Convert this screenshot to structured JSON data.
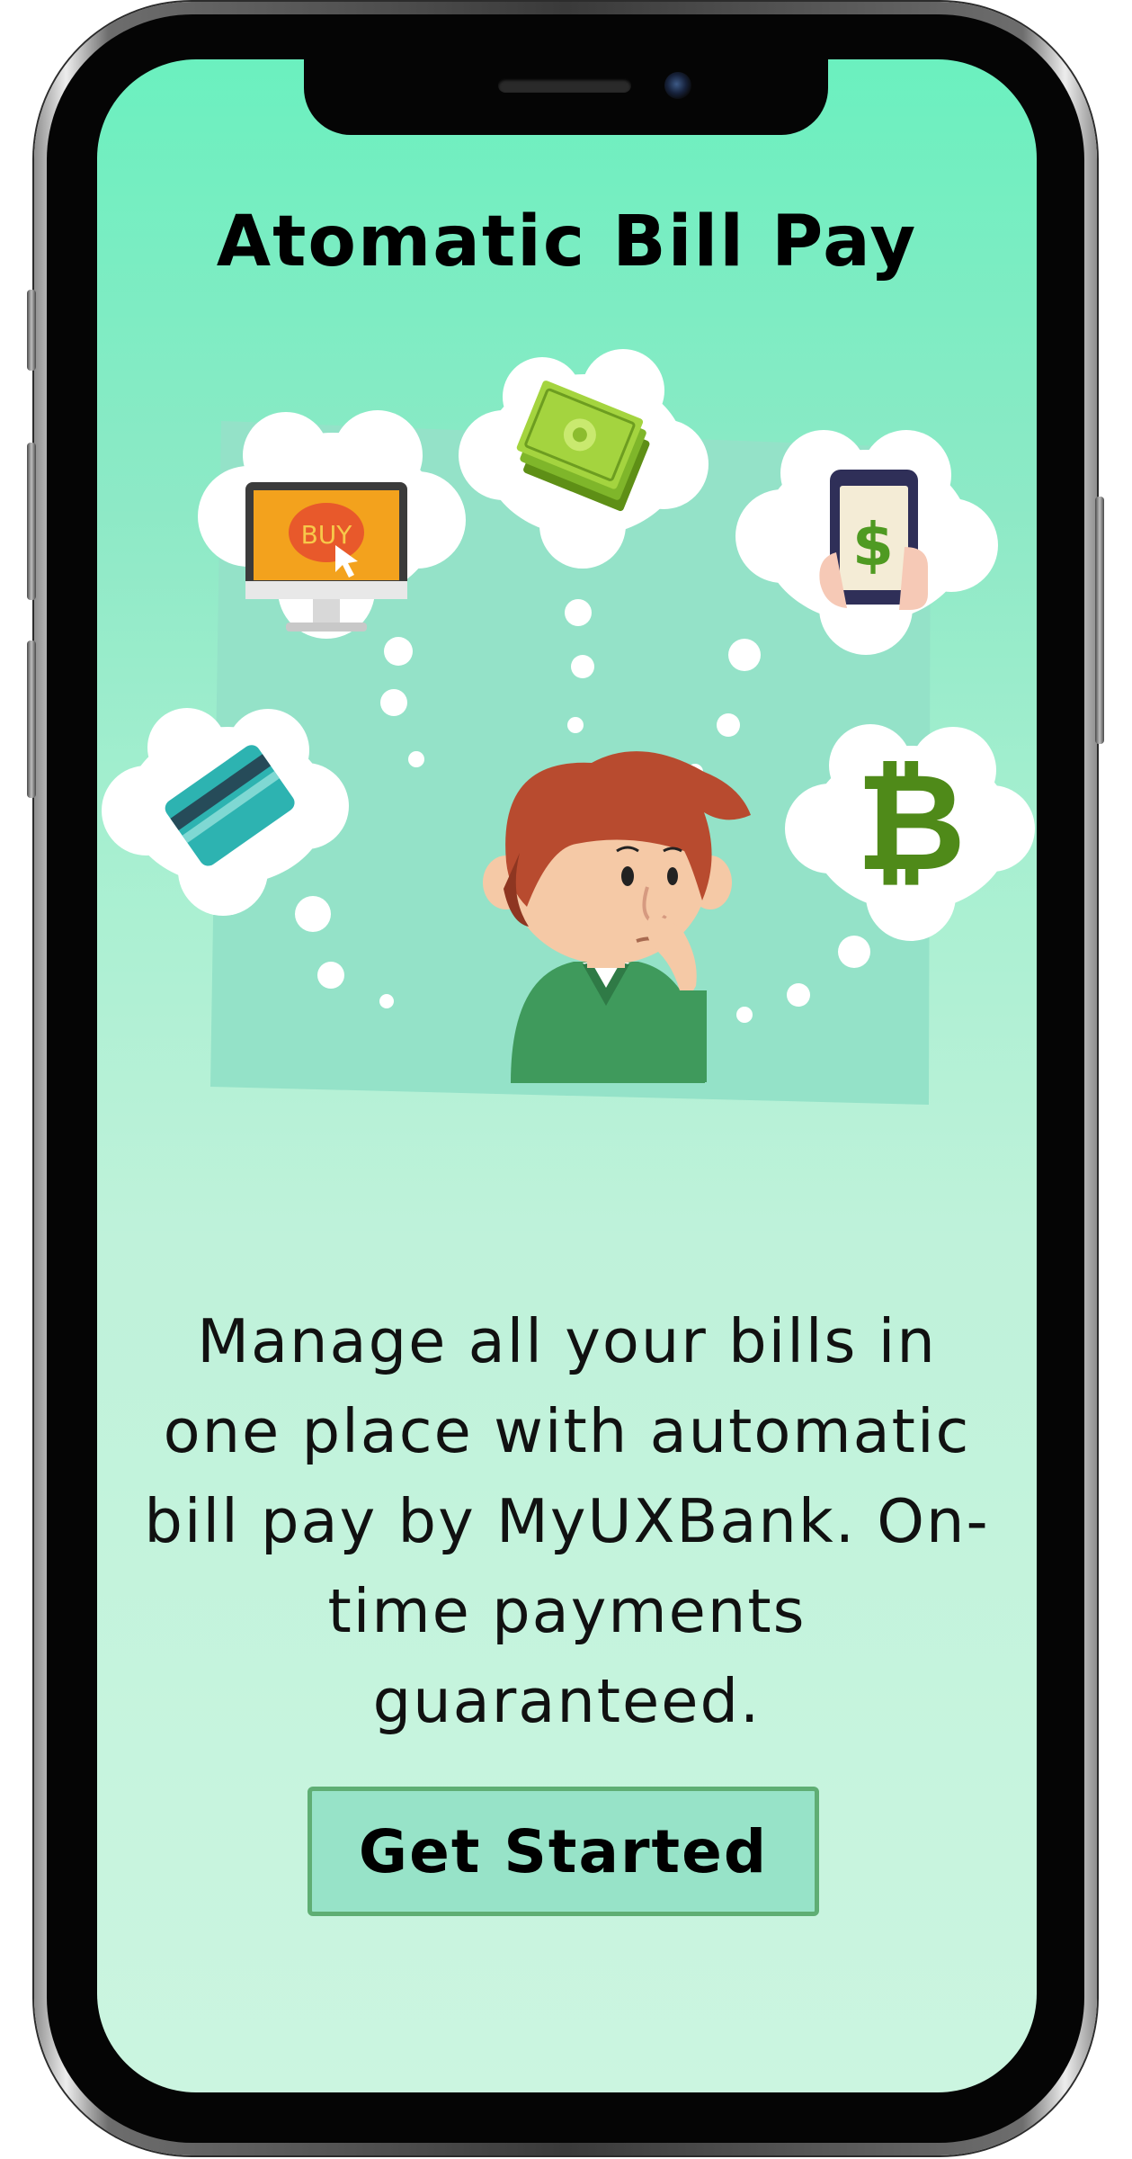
{
  "screen": {
    "title": "Atomatic Bill Pay",
    "description": "Manage all your bills in one place with automatic bill pay by MyUXBank. On-time payments guaranteed.",
    "cta_label": "Get Started"
  },
  "illustration": {
    "buy_label": "BUY",
    "icons": [
      "computer-buy-icon",
      "cash-icon",
      "phone-payment-icon",
      "credit-card-icon",
      "bitcoin-icon",
      "thinking-person"
    ]
  },
  "colors": {
    "screen_top": "#6bf0bf",
    "screen_bottom": "#cbf5e0",
    "button_fill": "#97e3c8",
    "button_border": "#5fae74",
    "text": "#000000"
  }
}
